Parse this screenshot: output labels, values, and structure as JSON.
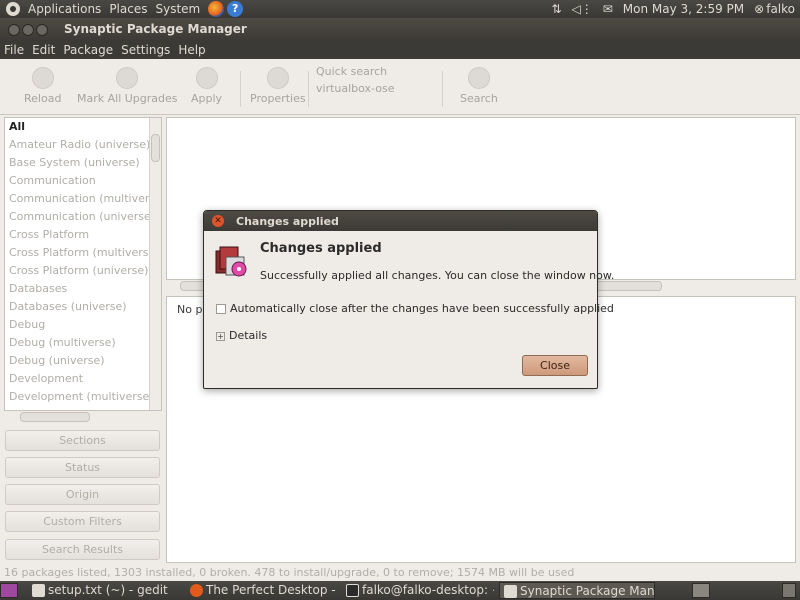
{
  "top_panel": {
    "menus": [
      "Applications",
      "Places",
      "System"
    ],
    "datetime": "Mon May  3,  2:59 PM",
    "user": "falko"
  },
  "window": {
    "title": "Synaptic Package Manager",
    "menubar": [
      "File",
      "Edit",
      "Package",
      "Settings",
      "Help"
    ]
  },
  "toolbar": {
    "reload": "Reload",
    "mark_all_upgrades": "Mark All Upgrades",
    "apply": "Apply",
    "properties": "Properties",
    "quick_search_label": "Quick search",
    "quick_search_value": "virtualbox-ose",
    "search": "Search"
  },
  "sections": [
    "All",
    "Amateur Radio (universe)",
    "Base System (universe)",
    "Communication",
    "Communication (multiverse)",
    "Communication (universe)",
    "Cross Platform",
    "Cross Platform (multiverse)",
    "Cross Platform (universe)",
    "Databases",
    "Databases (universe)",
    "Debug",
    "Debug (multiverse)",
    "Debug (universe)",
    "Development",
    "Development (multiverse)"
  ],
  "side_buttons": {
    "sections": "Sections",
    "status": "Status",
    "origin": "Origin",
    "custom_filters": "Custom Filters",
    "search_results": "Search Results"
  },
  "description_pane": {
    "text": "No pa"
  },
  "statusbar": "16 packages listed, 1303 installed, 0 broken. 478 to install/upgrade, 0 to remove; 1574 MB will be used",
  "dialog": {
    "title": "Changes applied",
    "heading": "Changes applied",
    "message": "Successfully applied all changes. You can close the window now.",
    "checkbox_label": "Automatically close after the changes have been successfully applied",
    "checkbox_checked": false,
    "details_label": "Details",
    "close_label": "Close"
  },
  "taskbar": {
    "tasks": [
      "setup.txt (~) - gedit",
      "The Perfect Desktop - ...",
      "falko@falko-desktop: ~",
      "Synaptic Package Mana..."
    ]
  },
  "colors": {
    "panel": "#3c3a36",
    "dialog_button": "#cf997a",
    "close_icon": "#e0542a"
  }
}
